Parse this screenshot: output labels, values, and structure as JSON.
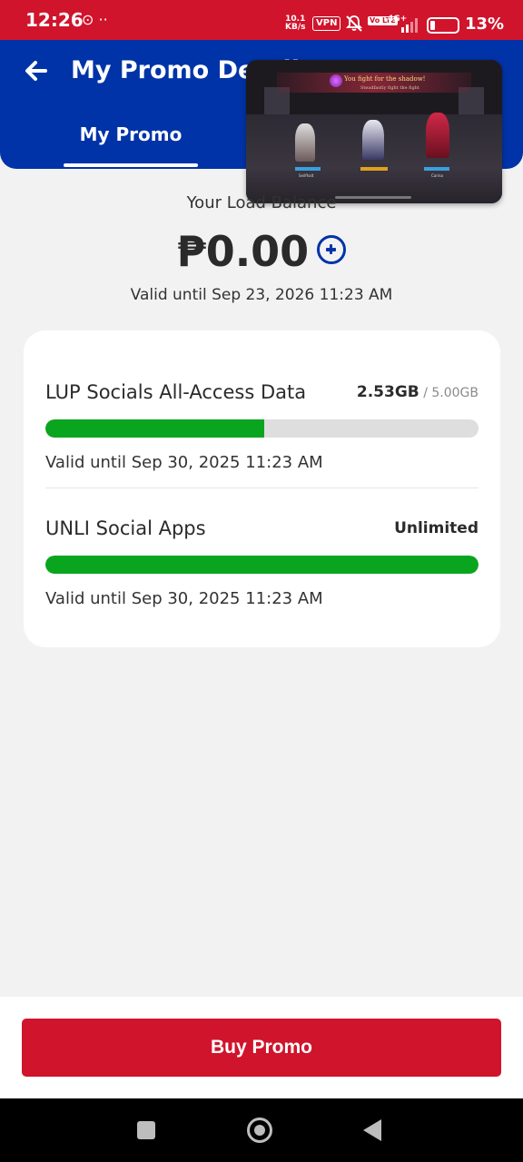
{
  "status_bar": {
    "time": "12:26",
    "left_icons": "⊙  ··",
    "net_speed_value": "10.1",
    "net_speed_unit": "KB/s",
    "vpn": "VPN",
    "volte": "Vo LTE",
    "network": "4G+",
    "battery": "13%"
  },
  "header": {
    "title": "My Promo Details",
    "tab_label": "My Promo"
  },
  "pip": {
    "banner_text": "You fight for the shadow!",
    "banner_sub": "Steadfastly fight the fight",
    "char_labels": [
      "Seilfhalt",
      "Carina"
    ]
  },
  "balance": {
    "label": "Your Load Balance",
    "amount": "₱0.00",
    "validity": "Valid until Sep 23, 2026 11:23 AM"
  },
  "promos": [
    {
      "name": "LUP Socials All-Access Data",
      "used": "2.53GB",
      "total": " / 5.00GB",
      "usage_fraction": 0.506,
      "validity": "Valid until Sep 30, 2025 11:23 AM"
    },
    {
      "name": "UNLI Social Apps",
      "used": "Unlimited",
      "total": "",
      "usage_fraction": 1.0,
      "validity": "Valid until Sep 30, 2025 11:23 AM"
    }
  ],
  "actions": {
    "buy_label": "Buy Promo"
  },
  "colors": {
    "brand_red": "#d0142c",
    "brand_blue": "#0033a8",
    "progress_green": "#0aa51e"
  }
}
